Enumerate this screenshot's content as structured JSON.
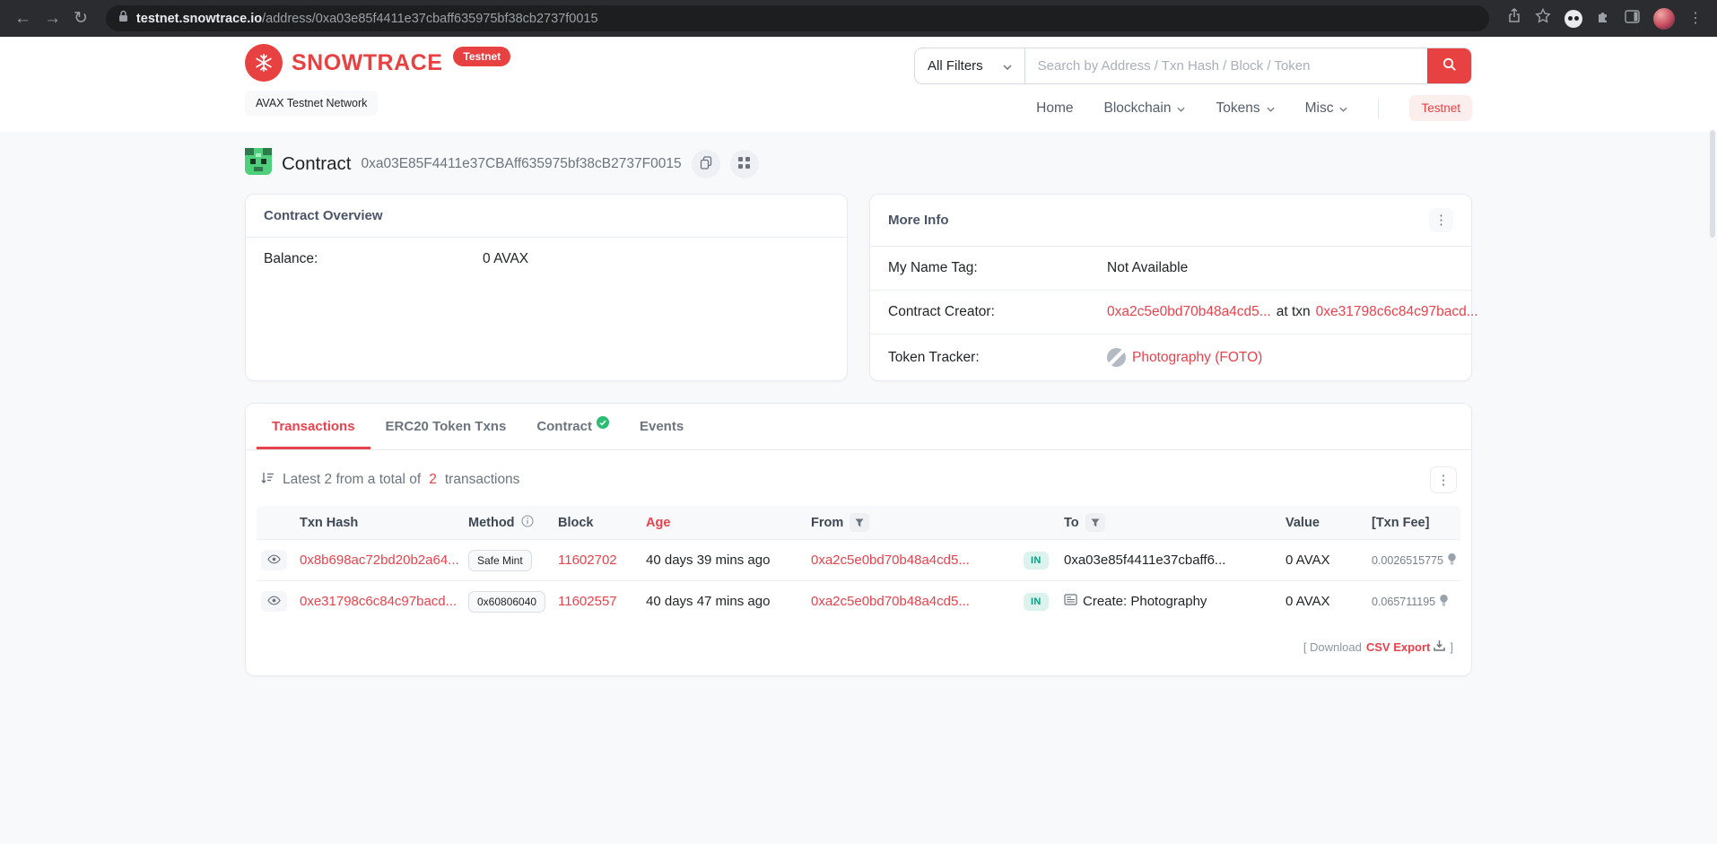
{
  "colors": {
    "brand_red": "#e84142",
    "link_red": "#e8424d",
    "in_green": "#00a186",
    "chrome_dark": "#2b2c2f"
  },
  "browser": {
    "url_domain": "testnet.snowtrace.io",
    "url_path": "/address/0xa03e85f4411e37cbaff635975bf38cb2737f0015"
  },
  "header": {
    "brand": "SNOWTRACE",
    "brand_badge": "Testnet",
    "network_label": "AVAX Testnet Network",
    "search": {
      "filter_label": "All Filters",
      "placeholder": "Search by Address / Txn Hash / Block / Token"
    },
    "nav": {
      "home": "Home",
      "blockchain": "Blockchain",
      "tokens": "Tokens",
      "misc": "Misc",
      "testnet": "Testnet"
    }
  },
  "page": {
    "title": "Contract",
    "address": "0xa03E85F4411e37CBAff635975bf38cB2737F0015"
  },
  "overview": {
    "title": "Contract Overview",
    "balance_label": "Balance:",
    "balance_value": "0 AVAX"
  },
  "more_info": {
    "title": "More Info",
    "name_tag_label": "My Name Tag:",
    "name_tag_value": "Not Available",
    "creator_label": "Contract Creator:",
    "creator_address": "0xa2c5e0bd70b48a4cd5...",
    "creator_mid": "at txn",
    "creator_txn": "0xe31798c6c84c97bacd...",
    "tracker_label": "Token Tracker:",
    "tracker_value": "Photography (FOTO)"
  },
  "tabs": {
    "transactions": "Transactions",
    "erc20": "ERC20 Token Txns",
    "contract": "Contract",
    "events": "Events"
  },
  "tx": {
    "summary_prefix": "Latest 2 from a total of",
    "summary_count": "2",
    "summary_suffix": "transactions",
    "columns": {
      "hash": "Txn Hash",
      "method": "Method",
      "block": "Block",
      "age": "Age",
      "from": "From",
      "to": "To",
      "value": "Value",
      "fee": "[Txn Fee]"
    },
    "rows": [
      {
        "hash": "0x8b698ac72bd20b2a64...",
        "method": "Safe Mint",
        "block": "11602702",
        "age": "40 days 39 mins ago",
        "from": "0xa2c5e0bd70b48a4cd5...",
        "direction": "IN",
        "to": "0xa03e85f4411e37cbaff6...",
        "value": "0 AVAX",
        "fee": "0.0026515775"
      },
      {
        "hash": "0xe31798c6c84c97bacd...",
        "method": "0x60806040",
        "block": "11602557",
        "age": "40 days 47 mins ago",
        "from": "0xa2c5e0bd70b48a4cd5...",
        "direction": "IN",
        "to": "Create: Photography",
        "value": "0 AVAX",
        "fee": "0.065711195"
      }
    ],
    "download_open": "[ Download",
    "download_link": "CSV Export",
    "download_close": "]"
  }
}
